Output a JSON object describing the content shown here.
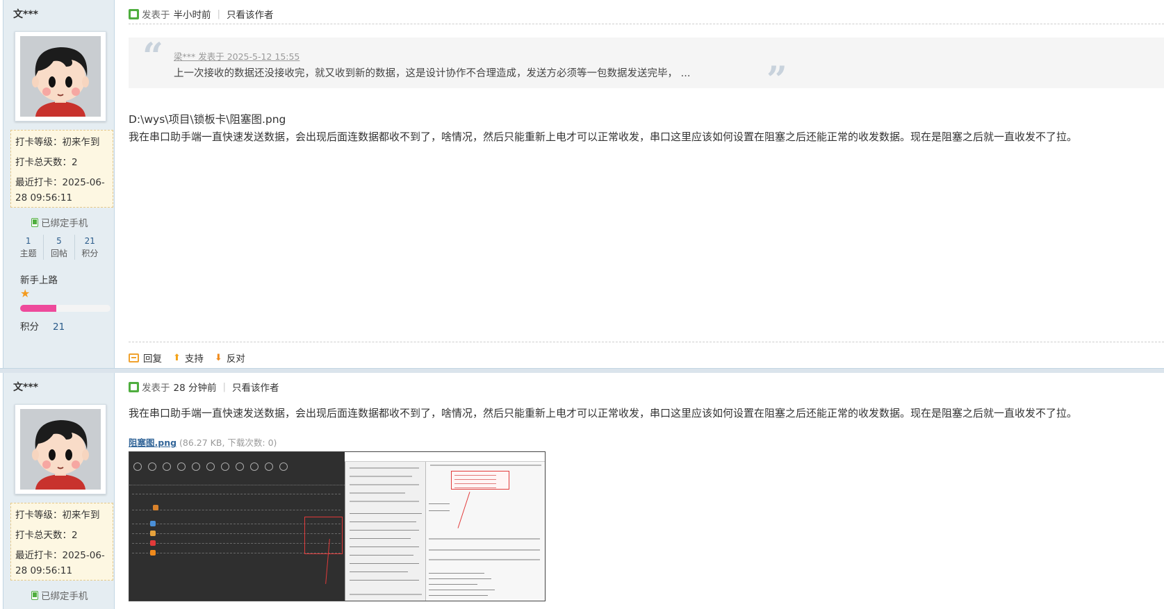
{
  "post1": {
    "author": "文***",
    "checkin": {
      "level": "打卡等级：初来乍到",
      "total": "打卡总天数：2",
      "recent": "最近打卡：2025-06-28 09:56:11"
    },
    "phone_label": "已绑定手机",
    "stats": [
      {
        "num": "1",
        "label": "主题"
      },
      {
        "num": "5",
        "label": "回帖"
      },
      {
        "num": "21",
        "label": "积分"
      }
    ],
    "rank": "新手上路",
    "rank_progress": 0.4,
    "points_label": "积分",
    "points_value": "21",
    "meta": {
      "posted_prefix": "发表于",
      "time": "半小时前",
      "only_author": "只看该作者"
    },
    "quote": {
      "author_line": "梁*** 发表于 2025-5-12 15:55",
      "text": "上一次接收的数据还没接收完，就又收到新的数据，这是设计协作不合理造成，发送方必须等一包数据发送完毕，  ..."
    },
    "path": "D:\\wys\\项目\\锁板卡\\阻塞图.png",
    "body": "我在串口助手端一直快速发送数据，会出现后面连数据都收不到了，啥情况，然后只能重新上电才可以正常收发，串口这里应该如何设置在阻塞之后还能正常的收发数据。现在是阻塞之后就一直收发不了拉。",
    "actions": {
      "reply": "回复",
      "support": "支持",
      "oppose": "反对"
    }
  },
  "post2": {
    "author": "文***",
    "checkin": {
      "level": "打卡等级：初来乍到",
      "total": "打卡总天数：2",
      "recent": "最近打卡：2025-06-28 09:56:11"
    },
    "phone_label": "已绑定手机",
    "meta": {
      "posted_prefix": "发表于",
      "time": "28 分钟前",
      "only_author": "只看该作者"
    },
    "body": "我在串口助手端一直快速发送数据，会出现后面连数据都收不到了，啥情况，然后只能重新上电才可以正常收发，串口这里应该如何设置在阻塞之后还能正常的收发数据。现在是阻塞之后就一直收发不了拉。",
    "attachment": {
      "name": "阻塞图.png",
      "info": "(86.27 KB, 下载次数: 0)"
    }
  },
  "colors": {
    "sidebar_bg": "#e5edf2",
    "link": "#336699",
    "rank_bar": "#ee4a9b",
    "star": "#f39a1e"
  }
}
